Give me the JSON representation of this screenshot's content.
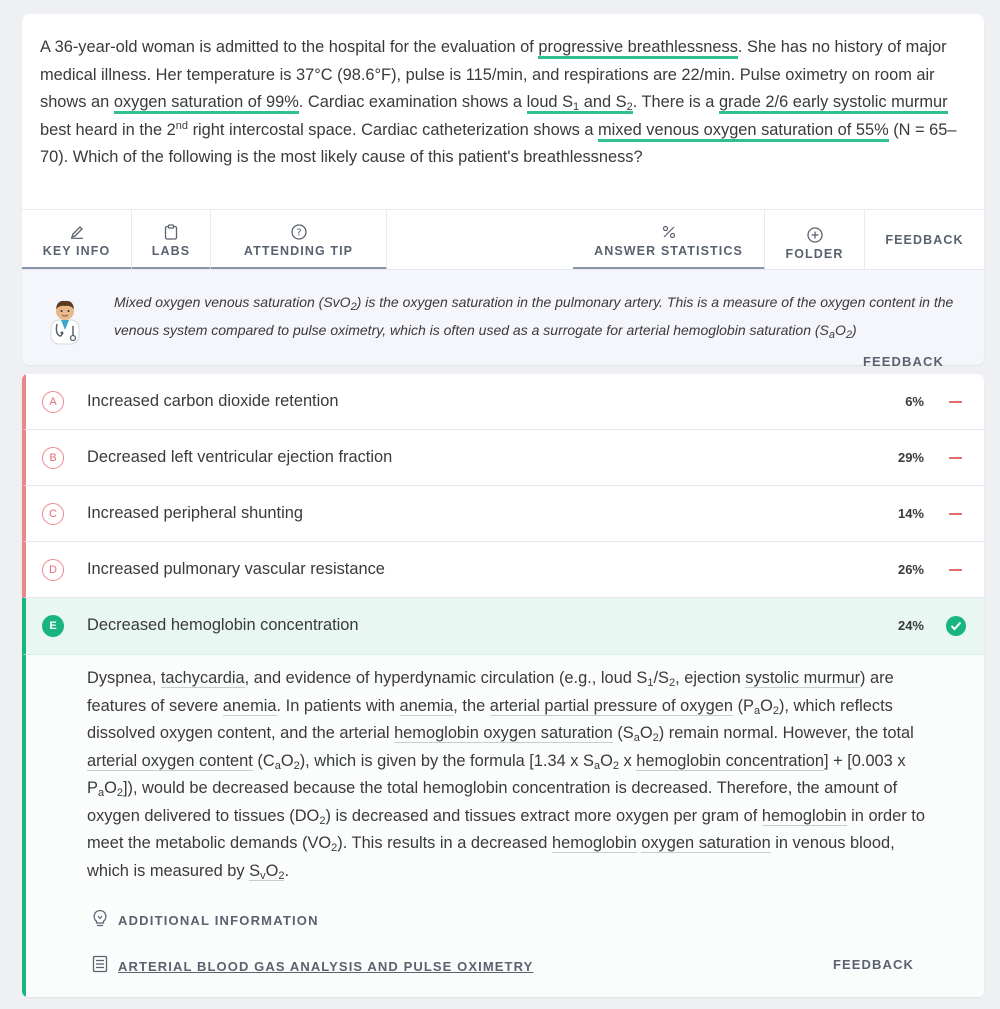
{
  "question": {
    "parts": [
      "A 36-year-old woman is admitted to the hospital for the evaluation of ",
      "progressive breathlessness",
      ". She has no history of major medical illness. Her temperature is 37°C (98.6°F), pulse is 115/min, and respirations are 22/min. Pulse oximetry on room air shows an ",
      "oxygen saturation of 99%",
      ". Cardiac examination shows a ",
      "loud S",
      "1",
      " and S",
      "2",
      ". There is a ",
      "grade 2/6 early systolic murmur",
      " best heard in the 2",
      "nd",
      " right intercostal space. Cardiac catheterization shows a ",
      "mixed venous oxygen saturation of 55%",
      " (N = 65–70). Which of the following is the most likely cause of this patient's breathlessness?"
    ]
  },
  "toolbar": {
    "key_info": "KEY INFO",
    "labs": "LABS",
    "attending_tip": "ATTENDING TIP",
    "answer_statistics": "ANSWER STATISTICS",
    "folder": "FOLDER",
    "feedback": "FEEDBACK"
  },
  "tip": {
    "line1_a": "Mixed oxygen venous saturation (SvO",
    "line1_sub": "2",
    "line1_b": ") is the oxygen saturation in the pulmonary artery. This is a measure of the oxygen content in the venous system compared to pulse oximetry, which is often used as a surrogate for arterial hemoglobin saturation (S",
    "line1_sub2": "a",
    "line1_c": "O",
    "line1_sub3": "2",
    "line1_d": ")",
    "feedback": "FEEDBACK"
  },
  "options": [
    {
      "letter": "A",
      "text": "Increased carbon dioxide retention",
      "pct": "6%"
    },
    {
      "letter": "B",
      "text": "Decreased left ventricular ejection fraction",
      "pct": "29%"
    },
    {
      "letter": "C",
      "text": "Increased peripheral shunting",
      "pct": "14%"
    },
    {
      "letter": "D",
      "text": "Increased pulmonary vascular resistance",
      "pct": "26%"
    },
    {
      "letter": "E",
      "text": "Decreased hemoglobin concentration",
      "pct": "24%"
    }
  ],
  "explanation": {
    "additional": "ADDITIONAL INFORMATION",
    "article": "ARTERIAL BLOOD GAS ANALYSIS AND PULSE OXIMETRY",
    "feedback": "FEEDBACK"
  },
  "colors": {
    "highlight": "#2fbf93",
    "correct": "#18b582",
    "incorrect": "#e46d72"
  }
}
